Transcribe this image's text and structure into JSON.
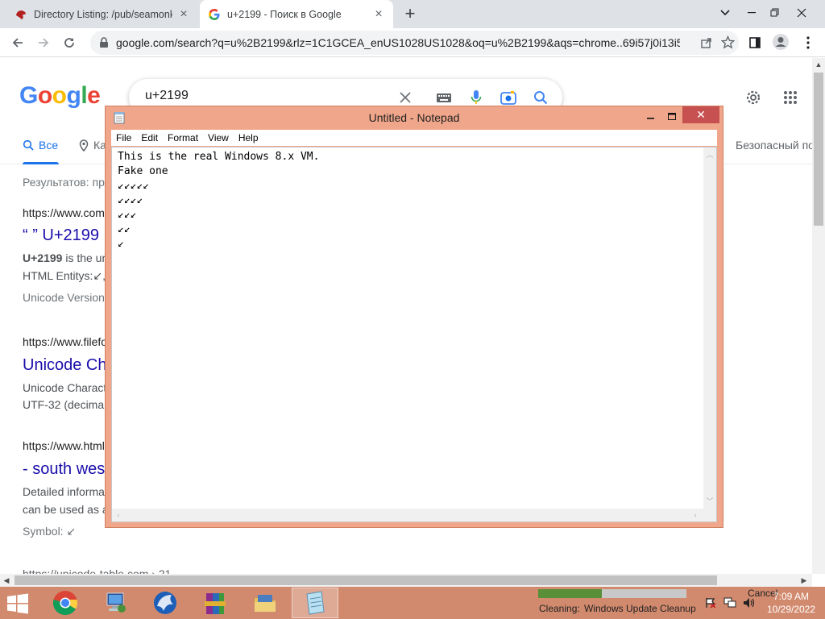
{
  "browser": {
    "tabs": [
      {
        "title": "Directory Listing: /pub/seamonke",
        "favicon": "seamonkey-icon"
      },
      {
        "title": "u+2199 - Поиск в Google",
        "favicon": "google-g-icon"
      }
    ],
    "url": "google.com/search?q=u%2B2199&rlz=1C1GCEA_enUS1028US1028&oq=u%2B2199&aqs=chrome..69i57j0i13i5..."
  },
  "google": {
    "logo": "Google",
    "query": "u+2199",
    "tabs": {
      "all": "Все",
      "maps_partial": "Ка"
    },
    "safe_search": "Безопасный по",
    "results_stats": "Результатов: пр",
    "results": [
      {
        "url": "https://www.com",
        "title": "“ ” U+2199",
        "line1_bold": "U+2199",
        "line1": " is the ur",
        "line2": "HTML Entitys:↙,",
        "meta": "Unicode Version"
      },
      {
        "url": "https://www.filefo",
        "title": "Unicode Ch",
        "line1": "Unicode Charact",
        "line2": "UTF-32 (decima"
      },
      {
        "url": "https://www.html",
        "title": "- south wes",
        "line1": "Detailed informa",
        "line2": "can be used as a",
        "meta": "Symbol: ↙"
      }
    ],
    "partial_next": "https://unicode-table.com › 21..."
  },
  "notepad": {
    "title": "Untitled - Notepad",
    "menu": [
      "File",
      "Edit",
      "Format",
      "View",
      "Help"
    ],
    "text": "This is the real Windows 8.x VM.\nFake one\n↙↙↙↙↙\n↙↙↙↙\n↙↙↙\n↙↙\n↙"
  },
  "taskbar": {
    "apps": [
      "chrome-icon",
      "network-computer-icon",
      "seamonkey-icon",
      "winrar-icon",
      "file-manager-icon",
      "notepad-icon"
    ],
    "cleanup": {
      "label": "Cleaning:",
      "task": "Windows Update Cleanup",
      "cancel": "Cancel",
      "progress": 0.43
    },
    "clock": {
      "time": "7:09 AM",
      "date": "10/29/2022"
    }
  },
  "colors": {
    "google_blue": "#1a73e8",
    "link": "#1a0dab",
    "notepad_frame": "#f0a68a",
    "taskbar": "#d28a6e",
    "close_red": "#c75050"
  }
}
